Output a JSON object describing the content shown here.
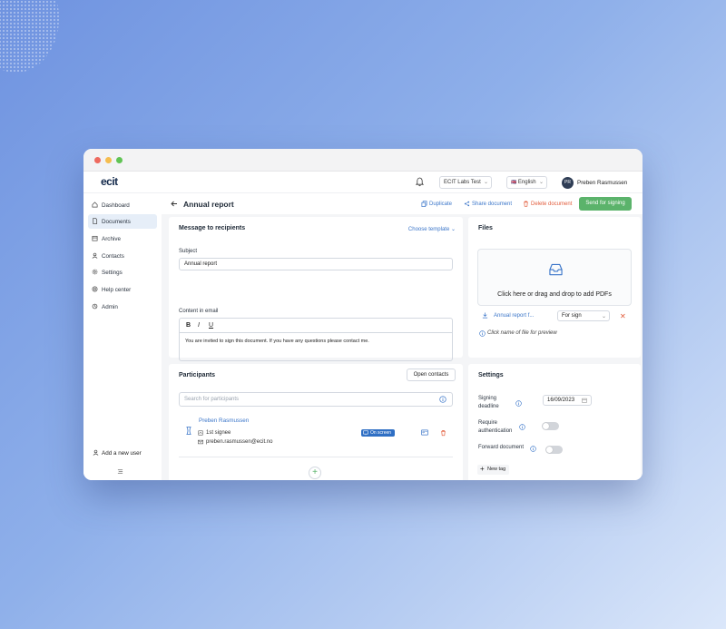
{
  "topbar": {
    "logo": "ecit",
    "org": "ECIT Labs Test",
    "language": "English",
    "flag": "🇬🇧",
    "avatar_initials": "PR",
    "user_name": "Preben Rasmussen"
  },
  "sidebar": {
    "items": [
      {
        "label": "Dashboard",
        "icon": "dashboard-icon"
      },
      {
        "label": "Documents",
        "icon": "document-icon"
      },
      {
        "label": "Archive",
        "icon": "archive-icon"
      },
      {
        "label": "Contacts",
        "icon": "contacts-icon"
      },
      {
        "label": "Settings",
        "icon": "gear-icon"
      },
      {
        "label": "Help center",
        "icon": "help-icon"
      },
      {
        "label": "Admin",
        "icon": "admin-icon"
      }
    ],
    "active": "Documents",
    "add_user": "Add a new user"
  },
  "header": {
    "title": "Annual report",
    "duplicate": "Duplicate",
    "share": "Share document",
    "delete": "Delete document",
    "send": "Send for signing"
  },
  "message": {
    "title": "Message to recipients",
    "choose_template": "Choose template",
    "subject_label": "Subject",
    "subject_value": "Annual report",
    "content_label": "Content in email",
    "toolbar": [
      "B",
      "I",
      "U"
    ],
    "body": "You are invited to sign this document. If you have any questions please contact me."
  },
  "files": {
    "title": "Files",
    "dropzone_text": "Click here or drag and drop to add PDFs",
    "file_name": "Annual report f...",
    "file_role": "For sign",
    "hint": "Click name of file for preview"
  },
  "participants": {
    "title": "Participants",
    "open_contacts": "Open contacts",
    "search_placeholder": "Search for participants",
    "items": [
      {
        "name": "Preben Rasmussen",
        "role": "1st signee",
        "email": "preben.rasmussen@ecit.no",
        "badge": "On screen"
      }
    ]
  },
  "settings": {
    "title": "Settings",
    "deadline_label": "Signing deadline",
    "deadline_value": "16/09/2023",
    "require_auth_label": "Require authentication",
    "require_auth": false,
    "forward_label": "Forward document",
    "forward": false,
    "new_tag": "New tag"
  },
  "colors": {
    "accent": "#3b76c9",
    "success": "#5bb36b",
    "danger": "#e25c3b"
  }
}
